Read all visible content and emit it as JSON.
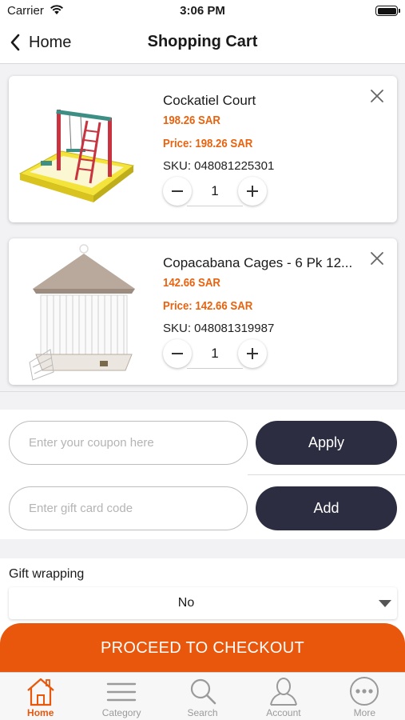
{
  "status_bar": {
    "carrier": "Carrier",
    "time": "3:06 PM"
  },
  "nav": {
    "back_label": "Home",
    "title": "Shopping Cart"
  },
  "cart_items": [
    {
      "name": "Cockatiel Court",
      "price": "198.26 SAR",
      "price_line": "Price: 198.26 SAR",
      "sku": "SKU: 048081225301",
      "quantity": "1",
      "image_icon": "bird-play-stand-image"
    },
    {
      "name": "Copacabana Cages - 6 Pk 12...",
      "price": "142.66 SAR",
      "price_line": "Price: 142.66 SAR",
      "sku": "SKU: 048081319987",
      "quantity": "1",
      "image_icon": "hexagonal-bird-cage-image"
    }
  ],
  "coupon": {
    "placeholder": "Enter your coupon here",
    "button_label": "Apply"
  },
  "gift_card": {
    "placeholder": "Enter gift card code",
    "button_label": "Add"
  },
  "gift_wrapping": {
    "label": "Gift wrapping",
    "selected": "No"
  },
  "checkout": {
    "label": "PROCEED TO CHECKOUT"
  },
  "tabs": [
    {
      "label": "Home",
      "icon": "home-icon",
      "active": true
    },
    {
      "label": "Category",
      "icon": "menu-icon",
      "active": false
    },
    {
      "label": "Search",
      "icon": "search-icon",
      "active": false
    },
    {
      "label": "Account",
      "icon": "account-icon",
      "active": false
    },
    {
      "label": "More",
      "icon": "more-icon",
      "active": false
    }
  ],
  "colors": {
    "accent": "#e8570c",
    "price": "#e8630f",
    "button_dark": "#2c2d40",
    "inactive_tab": "#9a9a9a"
  }
}
